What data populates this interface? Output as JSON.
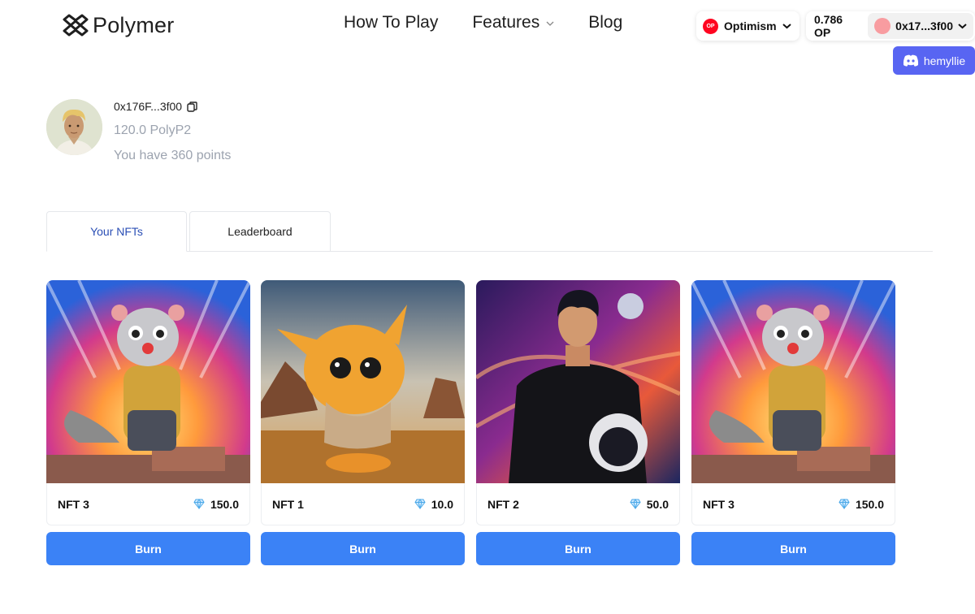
{
  "brand": {
    "name": "Polymer",
    "icon": "polymer-logo-icon"
  },
  "nav": {
    "how_to_play": "How To Play",
    "features": "Features",
    "blog": "Blog"
  },
  "wallet": {
    "network_badge": "OP",
    "network": "Optimism",
    "balance": "0.786 OP",
    "address": "0x17...3f00",
    "discord_user": "hemyllie",
    "accent": "#5865f2"
  },
  "profile": {
    "address": "0x176F...3f00",
    "balance": "120.0 PolyP2",
    "points": "You have 360 points"
  },
  "tabs": [
    {
      "label": "Your NFTs",
      "active": true
    },
    {
      "label": "Leaderboard",
      "active": false
    }
  ],
  "nfts": [
    {
      "name": "NFT 3",
      "value": "150.0",
      "art": "weasel-adventurer"
    },
    {
      "name": "NFT 1",
      "value": "10.0",
      "art": "fluffy-creature"
    },
    {
      "name": "NFT 2",
      "value": "50.0",
      "art": "astronaut-man"
    },
    {
      "name": "NFT 3",
      "value": "150.0",
      "art": "weasel-adventurer"
    }
  ],
  "burn_label": "Burn",
  "colors": {
    "primary": "#3b82f6",
    "tab_active": "#2b4fb5",
    "op_red": "#ff0420"
  }
}
